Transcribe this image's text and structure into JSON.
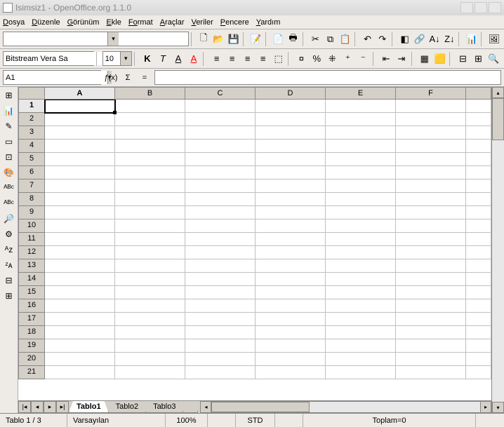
{
  "title": {
    "doc": "Isimsiz1",
    "app": "OpenOffice.org 1.1.0"
  },
  "menu": {
    "dosya": "osya",
    "dosya_u": "D",
    "duzenle": "üzenle",
    "duzenle_u": "D",
    "gorunum": "örünüm",
    "gorunum_u": "G",
    "ekle": "kle",
    "ekle_u": "E",
    "format": "mat",
    "format_u": "F",
    "format_u2": "o",
    "araclar": "raçlar",
    "araclar_u": "A",
    "veriler": "eriler",
    "veriler_u": "V",
    "pencere": "encere",
    "pencere_u": "P",
    "yardim": "ardım",
    "yardim_u": "Y"
  },
  "font": {
    "name": "Bitstream Vera Sa",
    "size": "10"
  },
  "bold": "K",
  "italic": "T",
  "underline": "A",
  "underline2": "A",
  "cell_ref": "A1",
  "fx": {
    "wizard": "ƒ(x)",
    "sum": "Σ",
    "eq": "="
  },
  "sheets": {
    "t1": "Tablo1",
    "t2": "Tablo2",
    "t3": "Tablo3"
  },
  "status": {
    "sheet": "Tablo 1 / 3",
    "style": "Varsayılan",
    "zoom": "100%",
    "mode": "STD",
    "sum": "Toplam=0"
  },
  "columns": [
    "A",
    "B",
    "C",
    "D",
    "E",
    "F"
  ],
  "rows": 21,
  "icons": {
    "new": "🗋",
    "open": "📂",
    "save": "💾",
    "edit": "📝",
    "pdf": "📄",
    "print": "🖶",
    "preview": "🔍",
    "cut": "✂",
    "copy": "⧉",
    "paste": "📋",
    "undo": "↶",
    "redo": "↷",
    "sort_asc": "A↓",
    "sort_desc": "Z↓",
    "chart": "📊",
    "hyperlink": "🔗",
    "gallery": "🖼",
    "navigator": "◧",
    "align_left": "≡",
    "align_center": "≡",
    "align_right": "≡",
    "align_justify": "≡",
    "merge": "⬚",
    "currency": "¤",
    "percent": "%",
    "std": "⁜",
    "dec_add": "⁺",
    "dec_sub": "⁻",
    "indent_dec": "⇤",
    "indent_inc": "⇥",
    "borders": "▦",
    "bg": "🟨",
    "font_color": "🔴",
    "side_insert": "⊞",
    "side_chart": "📊",
    "side_draw": "✎",
    "side_form": "▭",
    "side_autoformat": "⊡",
    "side_theme": "🎨",
    "side_spell": "ᴬᴮᶜ",
    "side_spell2": "ᴬᴮᶜ",
    "side_find": "🔎",
    "side_source": "⚙",
    "side_sort_a": "ᴬz",
    "side_sort_z": "ᶻᴀ",
    "side_group": "⊟",
    "side_ungroup": "⊞"
  }
}
